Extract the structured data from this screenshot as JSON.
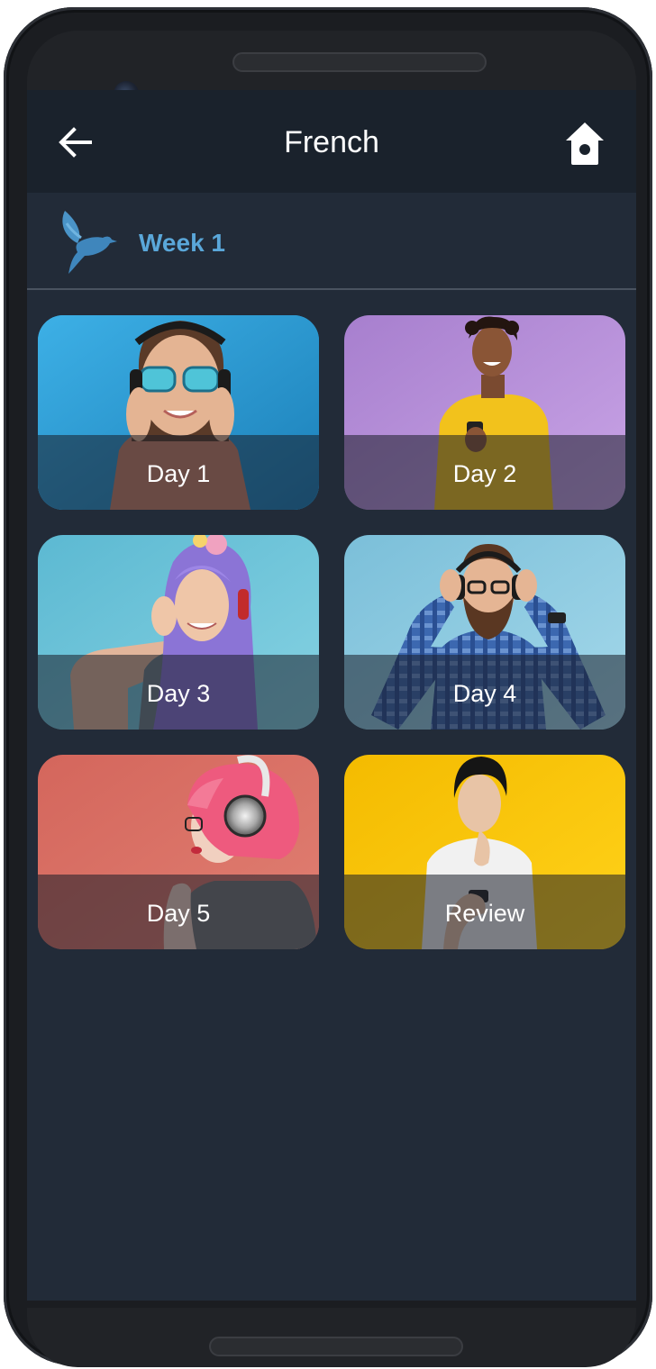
{
  "app_bar": {
    "title": "French",
    "back_icon": "arrow-left-icon",
    "home_icon": "home-icon"
  },
  "week": {
    "label": "Week 1",
    "icon": "bird-icon"
  },
  "cards": [
    {
      "label": "Day 1",
      "bg": "#2a9fd8"
    },
    {
      "label": "Day 2",
      "bg": "#b98fdb"
    },
    {
      "label": "Day 3",
      "bg": "#6fc6da"
    },
    {
      "label": "Day 4",
      "bg": "#88c6e0"
    },
    {
      "label": "Day 5",
      "bg": "#d8685e"
    },
    {
      "label": "Review",
      "bg": "#f6c200"
    }
  ],
  "colors": {
    "screen_bg": "#222b38",
    "app_bar_bg": "#1a222c",
    "accent": "#5aa7d9"
  }
}
